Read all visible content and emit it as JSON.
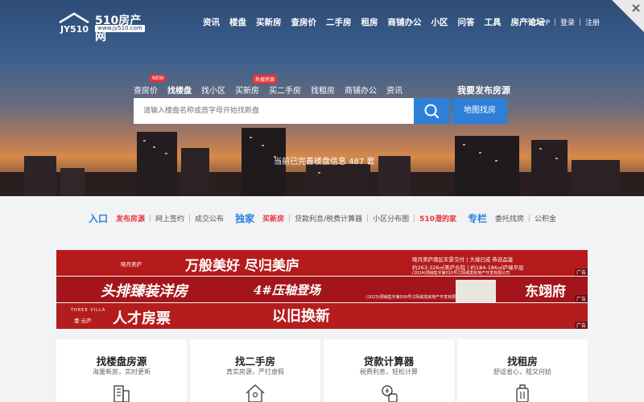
{
  "logo": {
    "brand": "510房产网",
    "url": "www.jy510.com",
    "mark": "JY510"
  },
  "nav": [
    "资讯",
    "楼盘",
    "买新房",
    "查房价",
    "二手房",
    "租房",
    "商铺办公",
    "小区",
    "问答",
    "工具",
    "房产论坛"
  ],
  "right_links": [
    "下载APP",
    "登录",
    "注册"
  ],
  "search_tabs": [
    {
      "label": "查房价",
      "badge": "NEW"
    },
    {
      "label": "找楼盘",
      "badge": ""
    },
    {
      "label": "找小区",
      "badge": ""
    },
    {
      "label": "买新房",
      "badge": "热搜房源"
    },
    {
      "label": "买二手房",
      "badge": ""
    },
    {
      "label": "找租房",
      "badge": ""
    },
    {
      "label": "商铺办公",
      "badge": ""
    },
    {
      "label": "资讯",
      "badge": ""
    }
  ],
  "search": {
    "placeholder": "请输入楼盘名称或首字母开始找新盘"
  },
  "publish_title": "我要发布房源",
  "map_button": "地图找房",
  "listing_count": "当前已完善楼盘信息 487 套",
  "quick": {
    "entry": "入口",
    "entry_items": [
      "发布房源",
      "网上签约",
      "成交公布"
    ],
    "exclusive": "独家",
    "exclusive_items": [
      "买新房",
      "贷款利息/税费计算器",
      "小区分布图",
      "510澄的家"
    ],
    "column": "专栏",
    "column_items": [
      "委托找房",
      "公积金"
    ]
  },
  "banners": [
    {
      "line": "万般美好 尽归美庐",
      "brand": "晓月美庐",
      "tagline": "晓月美庐南区实景交付 | 大境已成 恭迎品鉴",
      "area": "约263-326㎡美庐合院 | 约184-186㎡庐境平层",
      "reg": "(2024)预销售字第010号江阴城发房地产开发有限公司",
      "ad": "广告"
    },
    {
      "line": "头排臻装洋房",
      "mid": "4#压轴登场",
      "brand": "东翊府",
      "reg": "(2023)预销售字第039号江阴城发房地产开发有限公司",
      "ad": "广告"
    },
    {
      "line": "人才房票",
      "mid": "以旧换新",
      "brand": "壹·云庐",
      "en": "THREE VILLA",
      "ad": "广告"
    }
  ],
  "cards": [
    {
      "title": "找楼盘房源",
      "sub": "海量新房，实时更新",
      "icon": "building-icon"
    },
    {
      "title": "找二手房",
      "sub": "真实房源，严打虚假",
      "icon": "house-icon"
    },
    {
      "title": "贷款计算器",
      "sub": "税费利息，轻松计算",
      "icon": "calculator-icon"
    },
    {
      "title": "找租房",
      "sub": "舒适省心，租又何妨",
      "icon": "luggage-icon"
    }
  ]
}
